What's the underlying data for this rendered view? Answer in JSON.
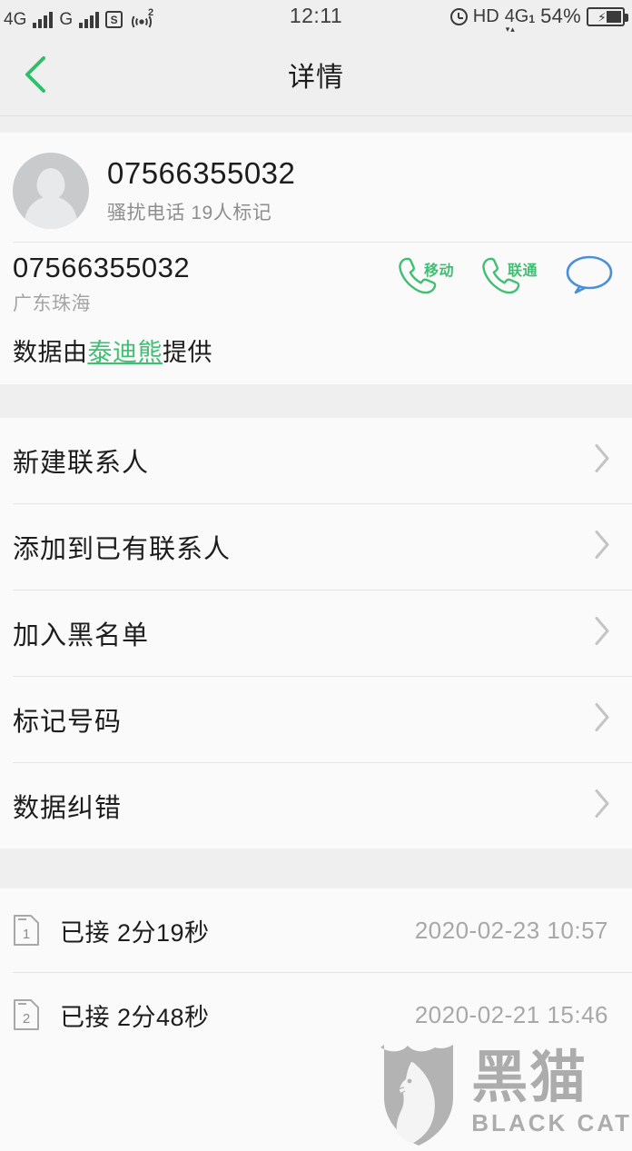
{
  "statusbar": {
    "left": {
      "net1": "4G",
      "net2": "G",
      "sim_icon_letter": "S",
      "hotspot_sup": "2"
    },
    "clock": "12:11",
    "right": {
      "hd": "HD",
      "net": "4G",
      "net_sub": "1",
      "arrow_down": "▾",
      "arrow_up": "▴",
      "battery_percent": "54%",
      "battery_bolt": "⚡"
    }
  },
  "header": {
    "title": "详情",
    "back_icon": "chevron-left-icon"
  },
  "contact": {
    "number": "07566355032",
    "tag": "骚扰电话 19人标记",
    "avatar_icon": "person-avatar-icon"
  },
  "number_row": {
    "number": "07566355032",
    "location": "广东珠海",
    "actions": [
      {
        "name": "call-mobile",
        "label": "移动",
        "icon": "phone-handset-icon",
        "color": "#3fbf72"
      },
      {
        "name": "call-unicom",
        "label": "联通",
        "icon": "phone-handset-icon",
        "color": "#3fbf72"
      },
      {
        "name": "send-message",
        "label": "",
        "icon": "message-bubble-icon",
        "color": "#4a90d9"
      }
    ]
  },
  "source": {
    "prefix": "数据由",
    "link": "泰迪熊",
    "suffix": "提供"
  },
  "menu": {
    "items": [
      {
        "label": "新建联系人",
        "name": "new-contact"
      },
      {
        "label": "添加到已有联系人",
        "name": "add-to-existing-contact"
      },
      {
        "label": "加入黑名单",
        "name": "add-to-blacklist"
      },
      {
        "label": "标记号码",
        "name": "mark-number"
      },
      {
        "label": "数据纠错",
        "name": "report-data-error"
      }
    ],
    "chevron_icon": "chevron-right-icon"
  },
  "calls": {
    "items": [
      {
        "sim": "1",
        "type": "已接",
        "duration": "2分19秒",
        "label": "已接 2分19秒",
        "datetime": "2020-02-23 10:57"
      },
      {
        "sim": "2",
        "type": "已接",
        "duration": "2分48秒",
        "label": "已接 2分48秒",
        "datetime": "2020-02-21 15:46"
      }
    ],
    "sim_icon": "sim-card-icon"
  },
  "watermark": {
    "cn": "黑猫",
    "en": "BLACK CAT",
    "icon": "cat-shield-logo"
  },
  "colors": {
    "accent_green": "#3fbf72",
    "message_blue": "#4a90d9",
    "bg": "#fafafa",
    "band": "#efefef",
    "text": "#1d1d1d",
    "muted": "#a4a4a4"
  }
}
